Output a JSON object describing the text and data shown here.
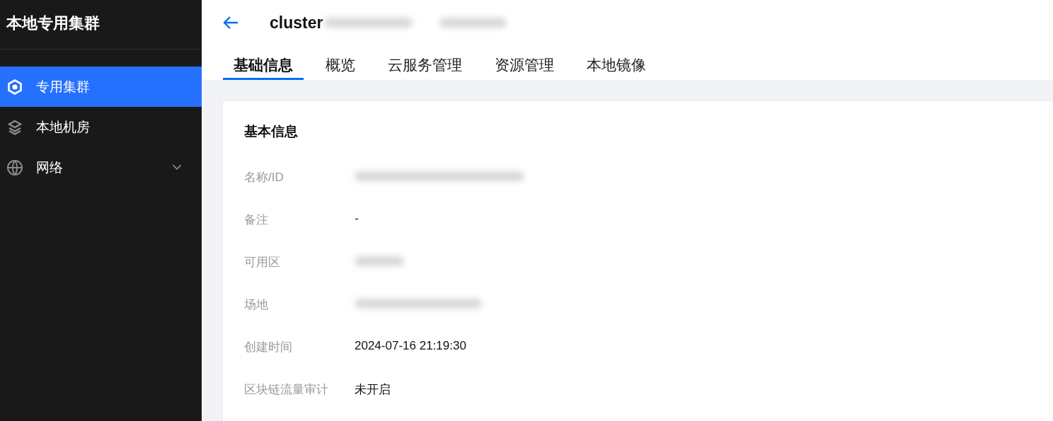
{
  "sidebar": {
    "title": "本地专用集群",
    "items": [
      {
        "label": "专用集群",
        "kind": "link",
        "selected": true
      },
      {
        "label": "本地机房",
        "kind": "link",
        "selected": false
      },
      {
        "label": "网络",
        "kind": "group",
        "selected": false
      }
    ]
  },
  "header": {
    "title": "cluster"
  },
  "tabs": [
    {
      "label": "基础信息",
      "selected": true
    },
    {
      "label": "概览",
      "selected": false
    },
    {
      "label": "云服务管理",
      "selected": false
    },
    {
      "label": "资源管理",
      "selected": false
    },
    {
      "label": "本地镜像",
      "selected": false
    }
  ],
  "card": {
    "title": "基本信息",
    "rows": [
      {
        "label": "名称/ID",
        "kind": "redacted"
      },
      {
        "label": "备注",
        "kind": "text",
        "value": "-"
      },
      {
        "label": "可用区",
        "kind": "redacted"
      },
      {
        "label": "场地",
        "kind": "redacted"
      },
      {
        "label": "创建时间",
        "kind": "text",
        "value": "2024-07-16 21:19:30"
      },
      {
        "label": "区块链流量审计",
        "kind": "text",
        "value": "未开启"
      }
    ]
  }
}
